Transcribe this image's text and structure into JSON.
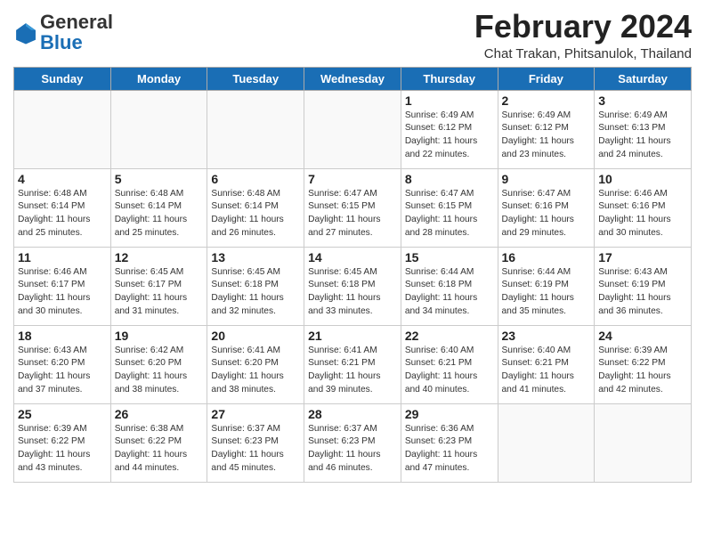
{
  "logo": {
    "general": "General",
    "blue": "Blue"
  },
  "title": "February 2024",
  "subtitle": "Chat Trakan, Phitsanulok, Thailand",
  "headers": [
    "Sunday",
    "Monday",
    "Tuesday",
    "Wednesday",
    "Thursday",
    "Friday",
    "Saturday"
  ],
  "weeks": [
    [
      {
        "day": "",
        "info": ""
      },
      {
        "day": "",
        "info": ""
      },
      {
        "day": "",
        "info": ""
      },
      {
        "day": "",
        "info": ""
      },
      {
        "day": "1",
        "info": "Sunrise: 6:49 AM\nSunset: 6:12 PM\nDaylight: 11 hours\nand 22 minutes."
      },
      {
        "day": "2",
        "info": "Sunrise: 6:49 AM\nSunset: 6:12 PM\nDaylight: 11 hours\nand 23 minutes."
      },
      {
        "day": "3",
        "info": "Sunrise: 6:49 AM\nSunset: 6:13 PM\nDaylight: 11 hours\nand 24 minutes."
      }
    ],
    [
      {
        "day": "4",
        "info": "Sunrise: 6:48 AM\nSunset: 6:14 PM\nDaylight: 11 hours\nand 25 minutes."
      },
      {
        "day": "5",
        "info": "Sunrise: 6:48 AM\nSunset: 6:14 PM\nDaylight: 11 hours\nand 25 minutes."
      },
      {
        "day": "6",
        "info": "Sunrise: 6:48 AM\nSunset: 6:14 PM\nDaylight: 11 hours\nand 26 minutes."
      },
      {
        "day": "7",
        "info": "Sunrise: 6:47 AM\nSunset: 6:15 PM\nDaylight: 11 hours\nand 27 minutes."
      },
      {
        "day": "8",
        "info": "Sunrise: 6:47 AM\nSunset: 6:15 PM\nDaylight: 11 hours\nand 28 minutes."
      },
      {
        "day": "9",
        "info": "Sunrise: 6:47 AM\nSunset: 6:16 PM\nDaylight: 11 hours\nand 29 minutes."
      },
      {
        "day": "10",
        "info": "Sunrise: 6:46 AM\nSunset: 6:16 PM\nDaylight: 11 hours\nand 30 minutes."
      }
    ],
    [
      {
        "day": "11",
        "info": "Sunrise: 6:46 AM\nSunset: 6:17 PM\nDaylight: 11 hours\nand 30 minutes."
      },
      {
        "day": "12",
        "info": "Sunrise: 6:45 AM\nSunset: 6:17 PM\nDaylight: 11 hours\nand 31 minutes."
      },
      {
        "day": "13",
        "info": "Sunrise: 6:45 AM\nSunset: 6:18 PM\nDaylight: 11 hours\nand 32 minutes."
      },
      {
        "day": "14",
        "info": "Sunrise: 6:45 AM\nSunset: 6:18 PM\nDaylight: 11 hours\nand 33 minutes."
      },
      {
        "day": "15",
        "info": "Sunrise: 6:44 AM\nSunset: 6:18 PM\nDaylight: 11 hours\nand 34 minutes."
      },
      {
        "day": "16",
        "info": "Sunrise: 6:44 AM\nSunset: 6:19 PM\nDaylight: 11 hours\nand 35 minutes."
      },
      {
        "day": "17",
        "info": "Sunrise: 6:43 AM\nSunset: 6:19 PM\nDaylight: 11 hours\nand 36 minutes."
      }
    ],
    [
      {
        "day": "18",
        "info": "Sunrise: 6:43 AM\nSunset: 6:20 PM\nDaylight: 11 hours\nand 37 minutes."
      },
      {
        "day": "19",
        "info": "Sunrise: 6:42 AM\nSunset: 6:20 PM\nDaylight: 11 hours\nand 38 minutes."
      },
      {
        "day": "20",
        "info": "Sunrise: 6:41 AM\nSunset: 6:20 PM\nDaylight: 11 hours\nand 38 minutes."
      },
      {
        "day": "21",
        "info": "Sunrise: 6:41 AM\nSunset: 6:21 PM\nDaylight: 11 hours\nand 39 minutes."
      },
      {
        "day": "22",
        "info": "Sunrise: 6:40 AM\nSunset: 6:21 PM\nDaylight: 11 hours\nand 40 minutes."
      },
      {
        "day": "23",
        "info": "Sunrise: 6:40 AM\nSunset: 6:21 PM\nDaylight: 11 hours\nand 41 minutes."
      },
      {
        "day": "24",
        "info": "Sunrise: 6:39 AM\nSunset: 6:22 PM\nDaylight: 11 hours\nand 42 minutes."
      }
    ],
    [
      {
        "day": "25",
        "info": "Sunrise: 6:39 AM\nSunset: 6:22 PM\nDaylight: 11 hours\nand 43 minutes."
      },
      {
        "day": "26",
        "info": "Sunrise: 6:38 AM\nSunset: 6:22 PM\nDaylight: 11 hours\nand 44 minutes."
      },
      {
        "day": "27",
        "info": "Sunrise: 6:37 AM\nSunset: 6:23 PM\nDaylight: 11 hours\nand 45 minutes."
      },
      {
        "day": "28",
        "info": "Sunrise: 6:37 AM\nSunset: 6:23 PM\nDaylight: 11 hours\nand 46 minutes."
      },
      {
        "day": "29",
        "info": "Sunrise: 6:36 AM\nSunset: 6:23 PM\nDaylight: 11 hours\nand 47 minutes."
      },
      {
        "day": "",
        "info": ""
      },
      {
        "day": "",
        "info": ""
      }
    ]
  ]
}
